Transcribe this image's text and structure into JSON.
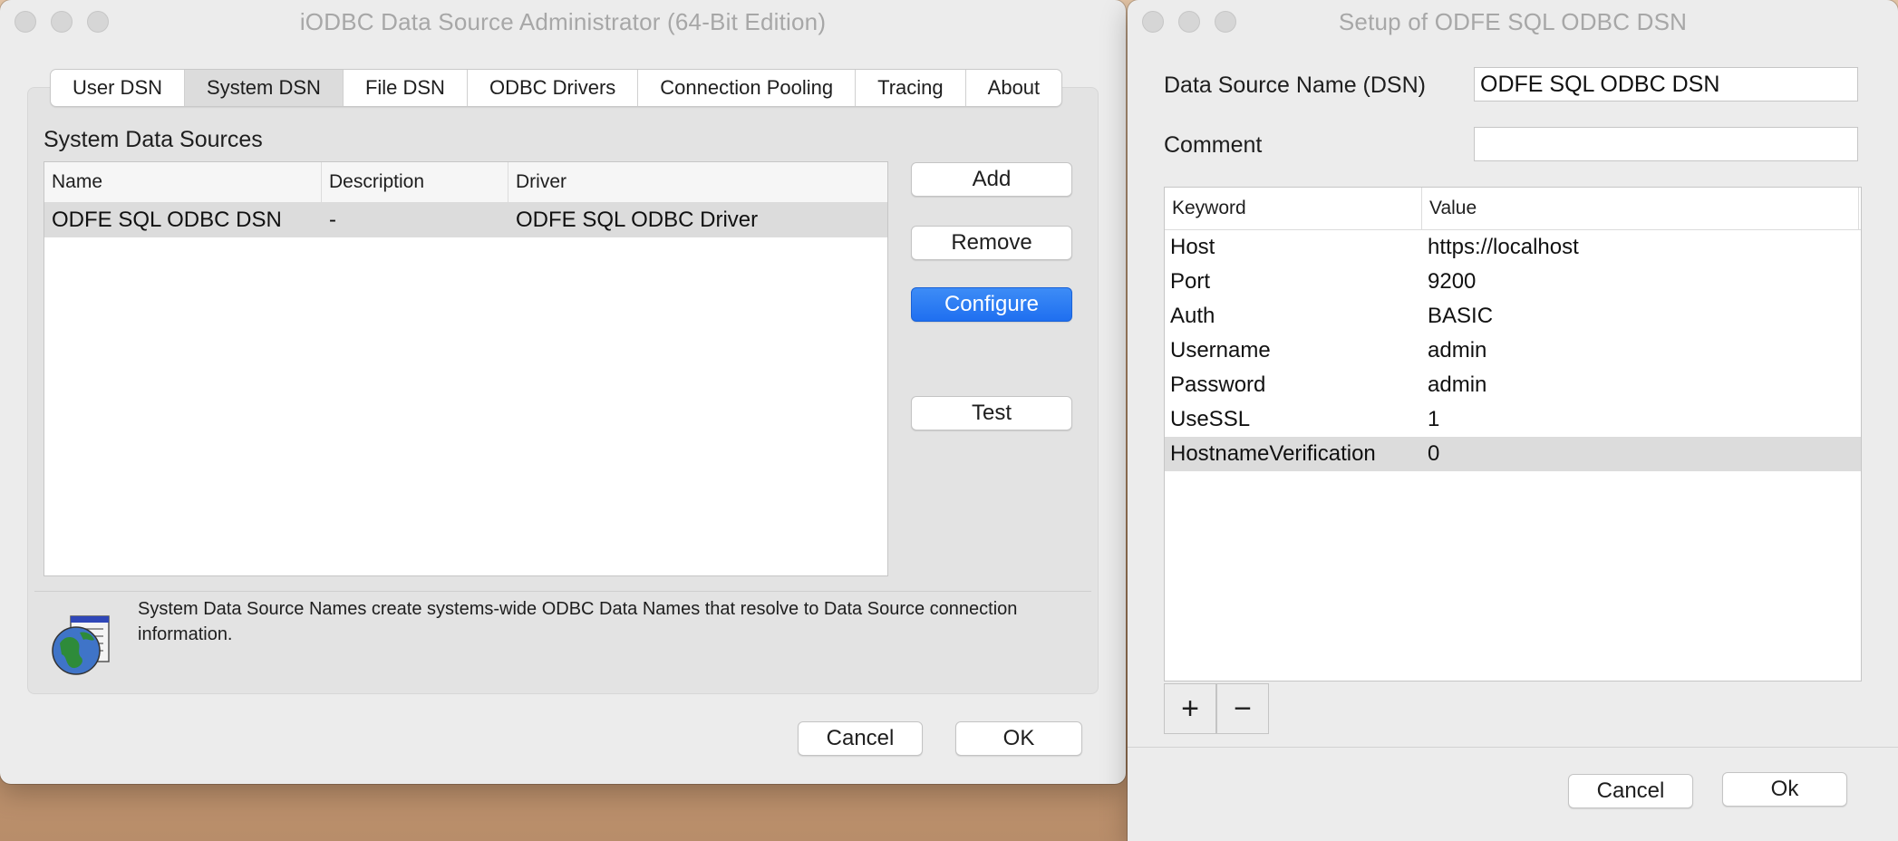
{
  "admin": {
    "title": "iODBC Data Source Administrator  (64-Bit Edition)",
    "tabs": [
      "User DSN",
      "System DSN",
      "File DSN",
      "ODBC Drivers",
      "Connection Pooling",
      "Tracing",
      "About"
    ],
    "active_tab": "System DSN",
    "section_label": "System Data Sources",
    "columns": [
      "Name",
      "Description",
      "Driver"
    ],
    "rows": [
      {
        "name": "ODFE SQL ODBC DSN",
        "description": "-",
        "driver": "ODFE SQL ODBC Driver"
      }
    ],
    "buttons": {
      "add": "Add",
      "remove": "Remove",
      "configure": "Configure",
      "test": "Test"
    },
    "info_text": "System Data Source Names create systems-wide ODBC Data Names that resolve to Data Source connection information.",
    "footer": {
      "cancel": "Cancel",
      "ok": "OK"
    }
  },
  "setup": {
    "title": "Setup of ODFE SQL ODBC DSN",
    "dsn_label": "Data Source Name (DSN)",
    "dsn_value": "ODFE SQL ODBC DSN",
    "comment_label": "Comment",
    "comment_value": "",
    "columns": [
      "Keyword",
      "Value"
    ],
    "rows": [
      {
        "keyword": "Host",
        "value": "https://localhost"
      },
      {
        "keyword": "Port",
        "value": "9200"
      },
      {
        "keyword": "Auth",
        "value": "BASIC"
      },
      {
        "keyword": "Username",
        "value": "admin"
      },
      {
        "keyword": "Password",
        "value": "admin"
      },
      {
        "keyword": "UseSSL",
        "value": "1"
      },
      {
        "keyword": "HostnameVerification",
        "value": "0"
      }
    ],
    "plus": "+",
    "minus": "−",
    "footer": {
      "cancel": "Cancel",
      "ok": "Ok"
    }
  },
  "colors": {
    "accent": "#1f6ff0",
    "selection": "#dcdcdc",
    "window_bg": "#ececec"
  }
}
